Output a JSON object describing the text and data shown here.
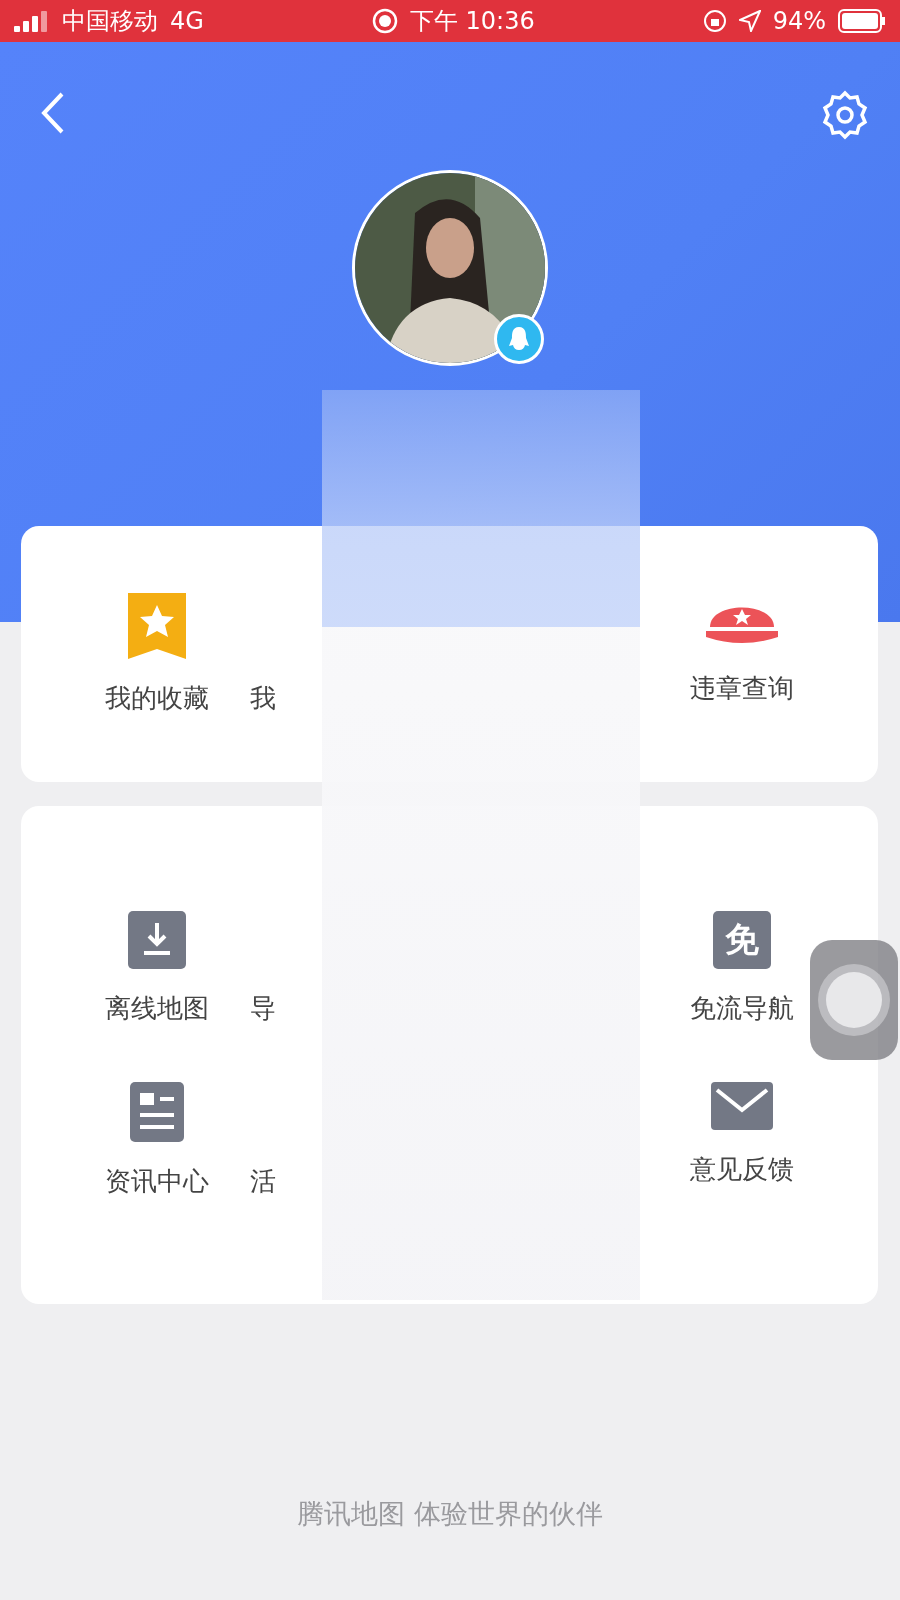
{
  "status_bar": {
    "carrier": "中国移动",
    "network": "4G",
    "time": "下午 10:36",
    "battery": "94%"
  },
  "shortcuts": [
    {
      "label": "我的收藏",
      "kind": "star"
    },
    {
      "label": "我"
    },
    {
      "label": "违章查询",
      "kind": "cap"
    }
  ],
  "tools": [
    [
      {
        "label": "离线地图",
        "kind": "download"
      },
      {
        "label": "导"
      },
      {
        "label": "免流导航",
        "kind": "glyph",
        "glyph": "免"
      }
    ],
    [
      {
        "label": "资讯中心",
        "kind": "news"
      },
      {
        "label": "活"
      },
      {
        "label": "意见反馈",
        "kind": "mail"
      }
    ]
  ],
  "footer": "腾讯地图 体验世界的伙伴"
}
